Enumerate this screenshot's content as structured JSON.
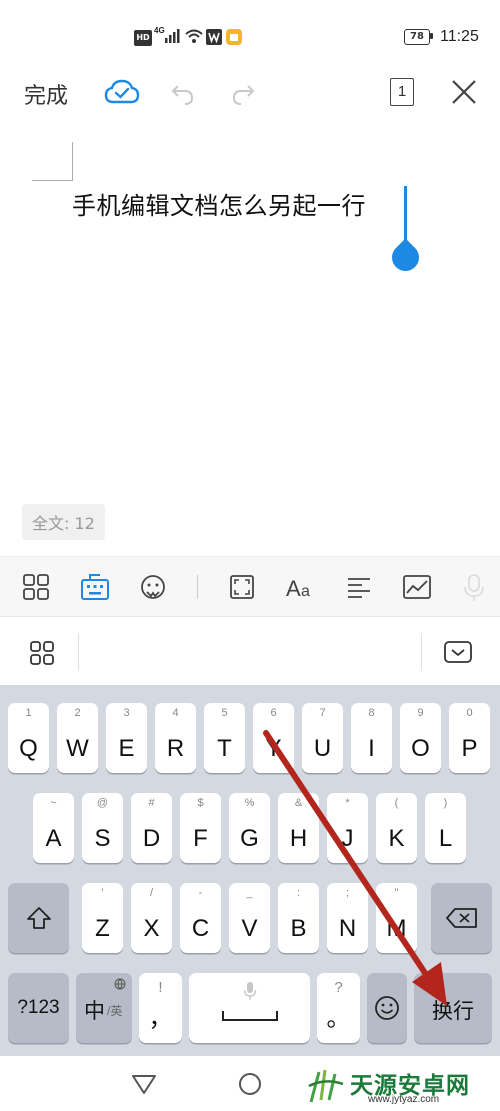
{
  "status_bar": {
    "hd": "HD",
    "net": "4G",
    "battery": "78",
    "time": "11:25"
  },
  "toolbar": {
    "done_label": "完成",
    "page_count": "1"
  },
  "document": {
    "text": "手机编辑文档怎么另起一行",
    "word_count": "全文: 12"
  },
  "keyboard": {
    "row1": [
      {
        "main": "Q",
        "sub": "1"
      },
      {
        "main": "W",
        "sub": "2"
      },
      {
        "main": "E",
        "sub": "3"
      },
      {
        "main": "R",
        "sub": "4"
      },
      {
        "main": "T",
        "sub": "5"
      },
      {
        "main": "Y",
        "sub": "6"
      },
      {
        "main": "U",
        "sub": "7"
      },
      {
        "main": "I",
        "sub": "8"
      },
      {
        "main": "O",
        "sub": "9"
      },
      {
        "main": "P",
        "sub": "0"
      }
    ],
    "row2": [
      {
        "main": "A",
        "sub": "~"
      },
      {
        "main": "S",
        "sub": "@"
      },
      {
        "main": "D",
        "sub": "#"
      },
      {
        "main": "F",
        "sub": "$"
      },
      {
        "main": "G",
        "sub": "%"
      },
      {
        "main": "H",
        "sub": "&"
      },
      {
        "main": "J",
        "sub": "*"
      },
      {
        "main": "K",
        "sub": "("
      },
      {
        "main": "L",
        "sub": ")"
      }
    ],
    "row3": [
      {
        "main": "Z",
        "sub": "'"
      },
      {
        "main": "X",
        "sub": "/"
      },
      {
        "main": "C",
        "sub": "-"
      },
      {
        "main": "V",
        "sub": "_"
      },
      {
        "main": "B",
        "sub": ":"
      },
      {
        "main": "N",
        "sub": ";"
      },
      {
        "main": "M",
        "sub": "\""
      }
    ],
    "num_label": "?123",
    "lang_main": "中",
    "lang_sub": "/英",
    "comma_main": "，",
    "comma_sub": "!",
    "period_main": "。",
    "period_sub": "?",
    "enter_label": "换行"
  },
  "watermark": {
    "name": "天源安卓网",
    "url": "www.jytyaz.com"
  },
  "colors": {
    "accent": "#1e88e5",
    "arrow": "#b3261e",
    "keyboard_bg": "#d4d8e0"
  }
}
